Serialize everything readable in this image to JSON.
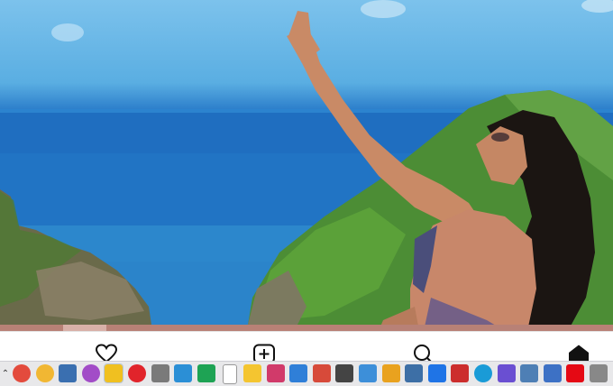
{
  "app_nav": {
    "items": [
      {
        "icon": "heart-icon"
      },
      {
        "icon": "add-post-icon"
      },
      {
        "icon": "search-icon"
      },
      {
        "icon": "home-icon"
      }
    ]
  },
  "taskbar": {
    "overflow_icon": "chevron-up-icon",
    "apps": [
      {
        "icon": "chrome-icon",
        "color": "#e34b3d"
      },
      {
        "icon": "chrome-icon-2",
        "color": "#f1b733"
      },
      {
        "icon": "screen-capture-icon",
        "color": "#3a6fb0"
      },
      {
        "icon": "picasa-icon",
        "color": "#a24cc7"
      },
      {
        "icon": "search-app-icon",
        "color": "#f0c020"
      },
      {
        "icon": "opera-icon",
        "color": "#e1242b"
      },
      {
        "icon": "filter-icon",
        "color": "#7a7a7a"
      },
      {
        "icon": "download-arrow-icon",
        "color": "#2b8fd6"
      },
      {
        "icon": "green-app-icon",
        "color": "#1ea354"
      },
      {
        "icon": "document-icon",
        "color": "#ffffff"
      },
      {
        "icon": "notes-icon",
        "color": "#f4c530"
      },
      {
        "icon": "butterfly-icon",
        "color": "#d13a6a"
      },
      {
        "icon": "calendar-icon",
        "color": "#2f7fd8"
      },
      {
        "icon": "snipping-icon",
        "color": "#d74a3a"
      },
      {
        "icon": "calculator-icon",
        "color": "#444444"
      },
      {
        "icon": "image-app-icon",
        "color": "#3d8fd9"
      },
      {
        "icon": "vector-icon",
        "color": "#e9a21f"
      },
      {
        "icon": "upload-icon",
        "color": "#3d6fa6"
      },
      {
        "icon": "dropbox-icon",
        "color": "#1f74e6"
      },
      {
        "icon": "media-player-icon",
        "color": "#cc2d2d"
      },
      {
        "icon": "edge-icon",
        "color": "#1a9bd7"
      },
      {
        "icon": "hat-icon",
        "color": "#6a4fd2"
      },
      {
        "icon": "desktop-icon",
        "color": "#4e7fb5"
      },
      {
        "icon": "monitor-icon",
        "color": "#3d71c5"
      },
      {
        "icon": "netflix-icon",
        "color": "#e50914"
      },
      {
        "icon": "settings-icon",
        "color": "#888888"
      }
    ]
  }
}
